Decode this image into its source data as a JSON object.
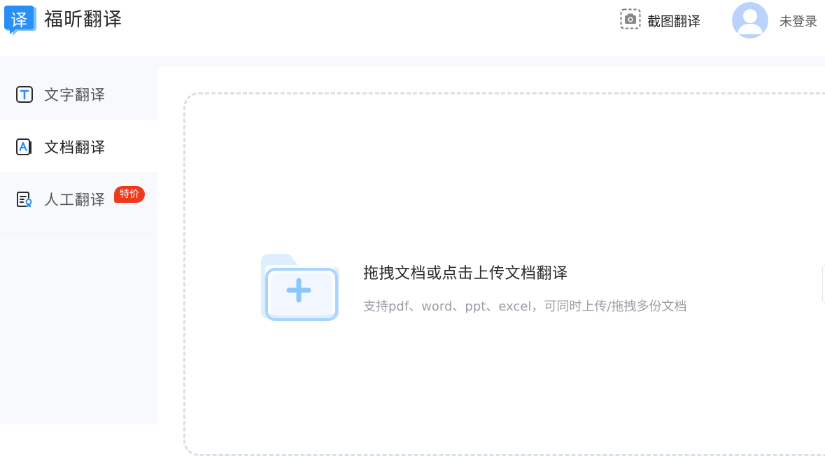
{
  "app": {
    "logo_char": "译",
    "name": "福昕翻译"
  },
  "header": {
    "screenshot_label": "截图翻译",
    "login_label": "未登录"
  },
  "sidebar": {
    "items": [
      {
        "label": "文字翻译",
        "icon": "text-t-icon",
        "active": false
      },
      {
        "label": "文档翻译",
        "icon": "document-a-icon",
        "active": true
      },
      {
        "label": "人工翻译",
        "icon": "human-certificate-icon",
        "active": false,
        "badge": "特价"
      }
    ]
  },
  "upload": {
    "title": "拖拽文档或点击上传文档翻译",
    "subtitle": "支持pdf、word、ppt、excel，可同时上传/拖拽多份文档",
    "icon": "folder-plus-icon"
  },
  "colors": {
    "brand_blue": "#2a8ff5",
    "badge_red": "#f0391c",
    "sidebar_bg": "#f7f9fc",
    "dashed_border": "#dcdfe4"
  }
}
